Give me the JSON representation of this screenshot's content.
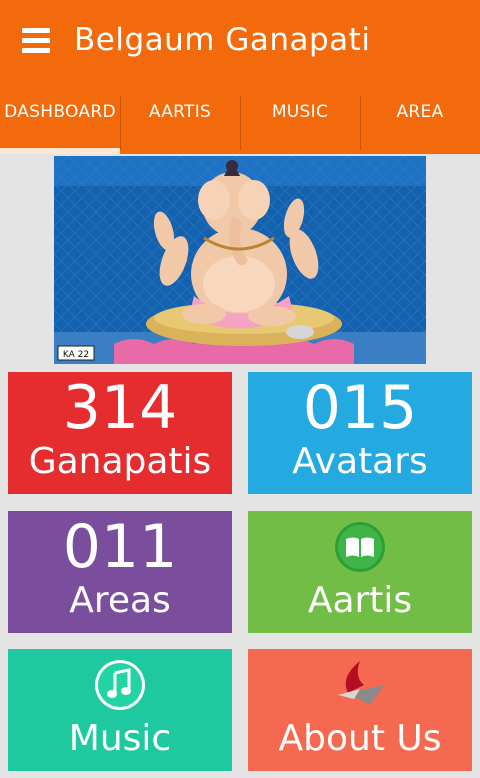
{
  "app": {
    "title": "Belgaum Ganapati"
  },
  "tabs": [
    {
      "label": "DASHBOARD",
      "active": true
    },
    {
      "label": "AARTIS",
      "active": false
    },
    {
      "label": "MUSIC",
      "active": false
    },
    {
      "label": "AREA",
      "active": false
    }
  ],
  "banner": {
    "plate_text": "KA 22"
  },
  "tiles": {
    "ganapatis": {
      "count": "314",
      "label": "Ganapatis",
      "color": "#e52d2f"
    },
    "avatars": {
      "count": "015",
      "label": "Avatars",
      "color": "#24a9e1"
    },
    "areas": {
      "count": "011",
      "label": "Areas",
      "color": "#7a4e9d"
    },
    "aartis": {
      "label": "Aartis",
      "icon": "book-icon",
      "color": "#72bd45"
    },
    "music": {
      "label": "Music",
      "icon": "music-note-icon",
      "color": "#1fc99f"
    },
    "about": {
      "label": "About Us",
      "icon": "app-logo-icon",
      "color": "#f4694f"
    }
  },
  "colors": {
    "appbar": "#f26a0b",
    "background": "#e4e4e4"
  }
}
